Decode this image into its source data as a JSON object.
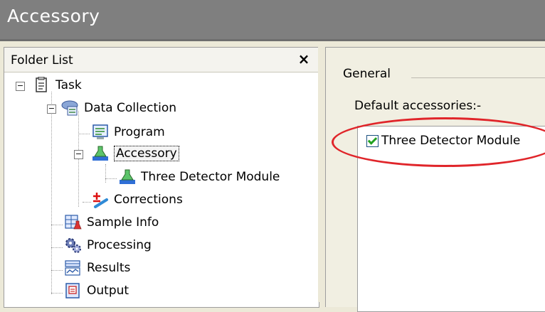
{
  "window": {
    "title": "Accessory"
  },
  "folder_list": {
    "header": "Folder List",
    "close_glyph": "×",
    "tree": {
      "task": "Task",
      "data_collection": "Data Collection",
      "program": "Program",
      "accessory": "Accessory",
      "three_detector_module": "Three Detector Module",
      "corrections": "Corrections",
      "sample_info": "Sample Info",
      "processing": "Processing",
      "results": "Results",
      "output": "Output"
    }
  },
  "general": {
    "group_label": "General",
    "default_label": "Default accessories:-",
    "accessories": [
      {
        "label": "Three Detector Module",
        "checked": true
      }
    ]
  },
  "colors": {
    "titlebar": "#7f7f7f",
    "annotation": "#e0252a",
    "checkmark": "#21a121"
  }
}
